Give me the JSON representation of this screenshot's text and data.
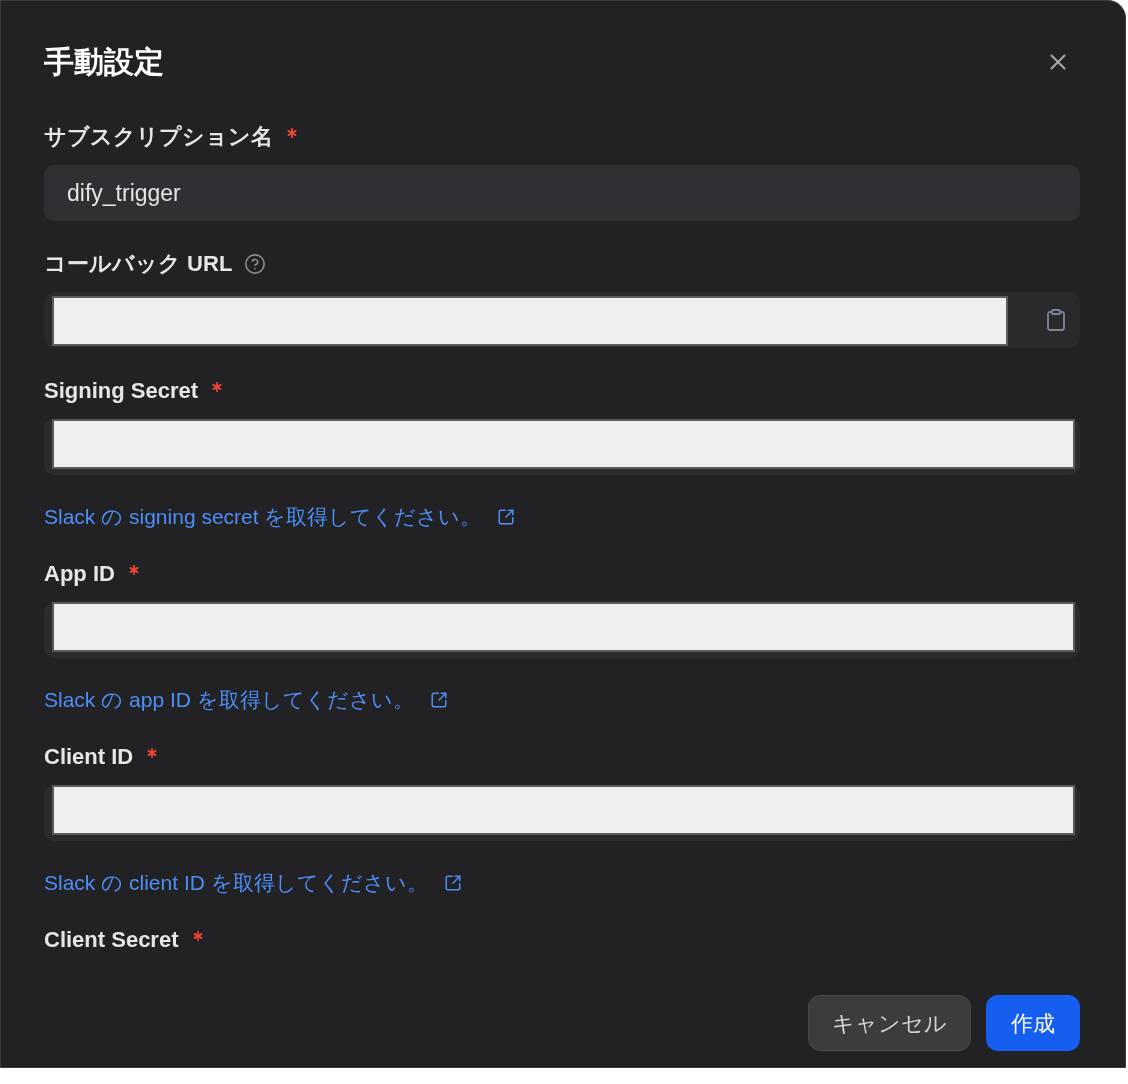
{
  "dialog": {
    "title": "手動設定"
  },
  "fields": [
    {
      "kind": "text",
      "label": "サブスクリプション名",
      "required": true,
      "value": "dify_trigger"
    },
    {
      "kind": "url",
      "label": "コールバック URL",
      "required": false
    },
    {
      "kind": "secret",
      "label": "Signing Secret",
      "required": true,
      "link": "Slack の signing secret を取得してください。"
    },
    {
      "kind": "secret",
      "label": "App ID",
      "required": true,
      "link": "Slack の app ID を取得してください。"
    },
    {
      "kind": "secret",
      "label": "Client ID",
      "required": true,
      "link": "Slack の client ID を取得してください。"
    },
    {
      "kind": "label",
      "label": "Client Secret",
      "required": true
    }
  ],
  "buttons": [
    {
      "label": "キャンセル",
      "kind": "secondary"
    },
    {
      "label": "作成",
      "kind": "primary"
    }
  ]
}
